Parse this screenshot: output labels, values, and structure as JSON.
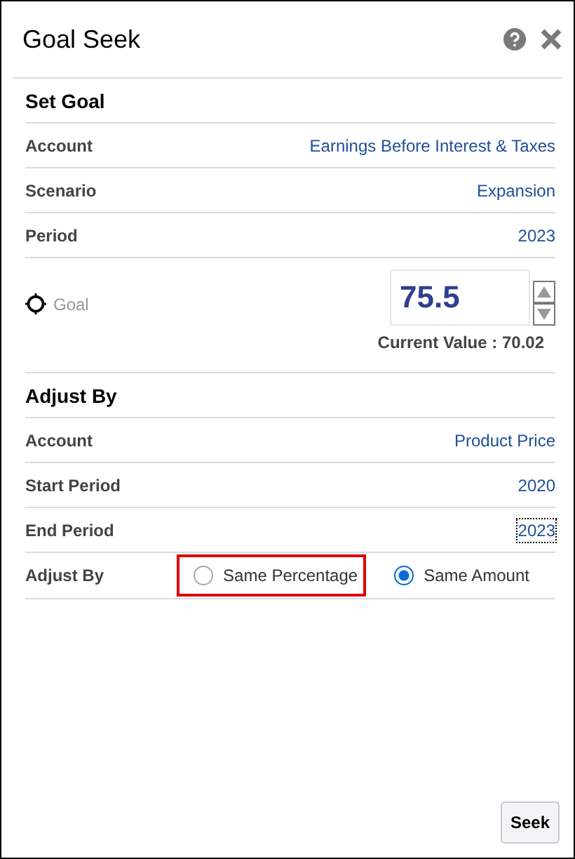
{
  "window": {
    "title": "Goal Seek"
  },
  "set_goal": {
    "heading": "Set Goal",
    "rows": [
      {
        "label": "Account",
        "value": "Earnings Before Interest & Taxes"
      },
      {
        "label": "Scenario",
        "value": "Expansion"
      },
      {
        "label": "Period",
        "value": "2023"
      }
    ],
    "goal": {
      "label": "Goal",
      "value": "75.5",
      "current_value": "Current Value : 70.02"
    }
  },
  "adjust_by": {
    "heading": "Adjust By",
    "rows": [
      {
        "label": "Account",
        "value": "Product Price",
        "focused": false
      },
      {
        "label": "Start Period",
        "value": "2020",
        "focused": false
      },
      {
        "label": "End Period",
        "value": "2023",
        "focused": true
      }
    ],
    "option_label": "Adjust By",
    "options": [
      {
        "label": "Same Percentage",
        "selected": false,
        "highlighted": true
      },
      {
        "label": "Same Amount",
        "selected": true,
        "highlighted": false
      }
    ]
  },
  "buttons": [
    "Seek"
  ]
}
